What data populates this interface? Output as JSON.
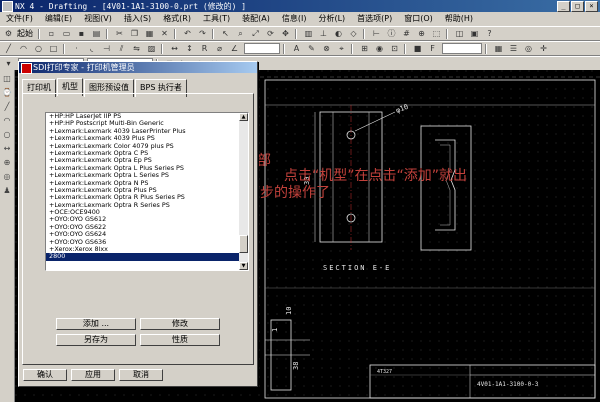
{
  "window": {
    "title": "NX 4 - Drafting - [4V01-1A1-3100-0.prt (修改的) ]"
  },
  "menubar": {
    "items": [
      "文件(F)",
      "编辑(E)",
      "视图(V)",
      "插入(S)",
      "格式(R)",
      "工具(T)",
      "装配(A)",
      "信息(I)",
      "分析(L)",
      "首选项(P)",
      "窗口(O)",
      "帮助(H)"
    ]
  },
  "toolbar": {
    "start_label": "起始"
  },
  "dialog": {
    "title": "SDI打印专家 - 打印机管理员",
    "tabs": [
      "打印机",
      "机型",
      "图形预设值",
      "BPS 执行者"
    ],
    "list": [
      "+HP:HP LaserJet IIP PS",
      "+HP:HP Postscript Multi-Bin Generic",
      "+Lexmark:Lexmark 4039 LaserPrinter Plus",
      "+Lexmark:Lexmark 4039 Plus PS",
      "+Lexmark:Lexmark Color 4079 plus PS",
      "+Lexmark:Lexmark Optra C PS",
      "+Lexmark:Lexmark Optra Ep PS",
      "+Lexmark:Lexmark Optra L Plus Series PS",
      "+Lexmark:Lexmark Optra L Series PS",
      "+Lexmark:Lexmark Optra N PS",
      "+Lexmark:Lexmark Optra Plus PS",
      "+Lexmark:Lexmark Optra R Plus Series PS",
      "+Lexmark:Lexmark Optra R Series PS",
      "+OCE:OCE9400",
      "+OYO:OYO GS612",
      "+OYO:OYO GS622",
      "+OYO:OYO GS624",
      "+OYO:OYO GS636",
      "+Xerox:Xerox 8lxx",
      "2800"
    ],
    "selected_index": 19,
    "buttons": {
      "add": "添加 ...",
      "modify": "修改",
      "save_as": "另存为",
      "properties": "性质",
      "ok": "确认",
      "apply": "应用",
      "cancel": "取消"
    }
  },
  "drawing": {
    "section_label": "SECTION E-E",
    "dim_phi10": "φ10",
    "dim_30": "30",
    "dim_10": "10",
    "dim_38": "38",
    "dim_1": "1",
    "title_block_code": "4V01-1A1-3100-0-3",
    "title_block_small": "4T327"
  },
  "annotation": {
    "line1": "第三部",
    "line2": "点击“机型”在点击“添加”就出",
    "line3": "现下步的操作了"
  },
  "colors": {
    "annotation": "#c2413b",
    "drawing_line": "#e6e6e6",
    "grid": "#444444",
    "title_bg": "#0a246a"
  }
}
